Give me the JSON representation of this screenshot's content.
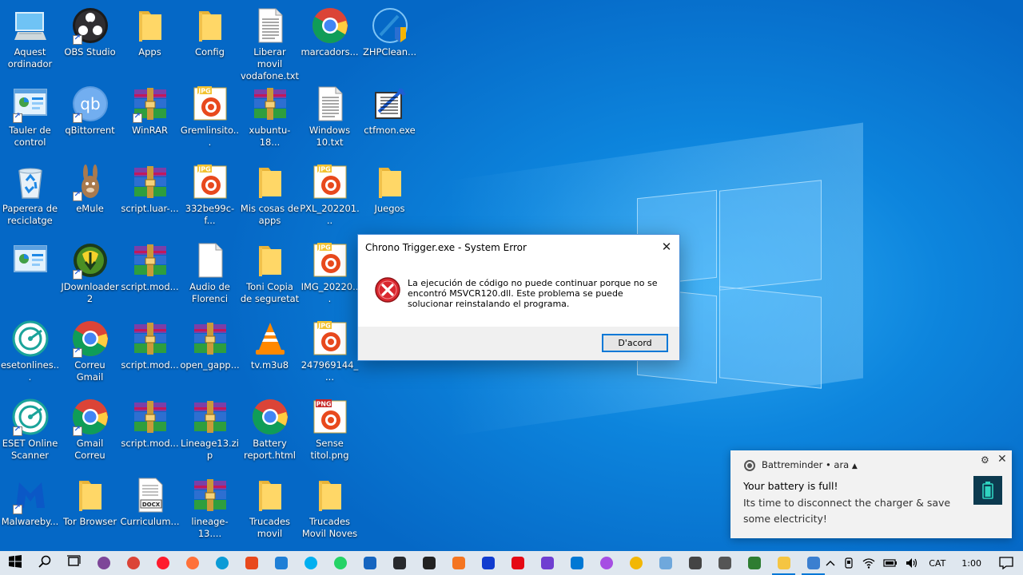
{
  "desktop": {
    "icons": [
      {
        "label": "Aquest ordinador",
        "icon": "this-pc-icon",
        "shortcut": false
      },
      {
        "label": "OBS Studio",
        "icon": "obs-icon",
        "shortcut": true
      },
      {
        "label": "Apps",
        "icon": "folder-icon",
        "shortcut": false
      },
      {
        "label": "Config",
        "icon": "folder-icon",
        "shortcut": false
      },
      {
        "label": "Liberar movil vodafone.txt",
        "icon": "text-file-icon",
        "shortcut": false
      },
      {
        "label": "marcadors...",
        "icon": "chrome-icon",
        "shortcut": false
      },
      {
        "label": "ZHPClean...",
        "icon": "zhpcleaner-icon",
        "shortcut": false
      },
      {
        "label": "Tauler de control",
        "icon": "control-panel-icon",
        "shortcut": true
      },
      {
        "label": "qBittorrent",
        "icon": "qbittorrent-icon",
        "shortcut": true
      },
      {
        "label": "WinRAR",
        "icon": "winrar-icon",
        "shortcut": true
      },
      {
        "label": "Gremlinsito...",
        "icon": "jpg-file-icon",
        "shortcut": false
      },
      {
        "label": "xubuntu-18...",
        "icon": "winrar-icon",
        "shortcut": false
      },
      {
        "label": "Windows 10.txt",
        "icon": "text-file-icon",
        "shortcut": false
      },
      {
        "label": "ctfmon.exe",
        "icon": "ctfmon-icon",
        "shortcut": false
      },
      {
        "label": "Paperera de reciclatge",
        "icon": "recycle-bin-icon",
        "shortcut": false
      },
      {
        "label": "eMule",
        "icon": "emule-icon",
        "shortcut": true
      },
      {
        "label": "script.luar-...",
        "icon": "winrar-icon",
        "shortcut": false
      },
      {
        "label": "332be99c-f...",
        "icon": "jpg-file-icon",
        "shortcut": false
      },
      {
        "label": "Mis cosas de apps",
        "icon": "folder-icon",
        "shortcut": false
      },
      {
        "label": "PXL_202201...",
        "icon": "jpg-file-icon",
        "shortcut": false
      },
      {
        "label": "Juegos",
        "icon": "folder-icon",
        "shortcut": false
      },
      {
        "label": "",
        "icon": "control-panel-icon",
        "shortcut": false
      },
      {
        "label": "JDownloader 2",
        "icon": "jdownloader-icon",
        "shortcut": true
      },
      {
        "label": "script.mod...",
        "icon": "winrar-icon",
        "shortcut": false
      },
      {
        "label": "Audio de Florenci",
        "icon": "blank-file-icon",
        "shortcut": false
      },
      {
        "label": "Toni Copia de seguretat",
        "icon": "folder-icon",
        "shortcut": false
      },
      {
        "label": "IMG_20220...",
        "icon": "jpg-file-icon",
        "shortcut": false
      },
      {
        "label": "esetonlines...",
        "icon": "eset-icon",
        "shortcut": false
      },
      {
        "label": "Correu Gmail",
        "icon": "chrome-icon",
        "shortcut": true
      },
      {
        "label": "script.mod...",
        "icon": "winrar-icon",
        "shortcut": false
      },
      {
        "label": "open_gapp...",
        "icon": "winrar-icon",
        "shortcut": false
      },
      {
        "label": "tv.m3u8",
        "icon": "vlc-icon",
        "shortcut": false
      },
      {
        "label": "247969144_...",
        "icon": "jpg-file-icon",
        "shortcut": false
      },
      {
        "label": "ESET Online Scanner",
        "icon": "eset-icon",
        "shortcut": true
      },
      {
        "label": "Gmail Correu",
        "icon": "chrome-icon",
        "shortcut": true
      },
      {
        "label": "script.mod...",
        "icon": "winrar-icon",
        "shortcut": false
      },
      {
        "label": "Lineage13.zip",
        "icon": "winrar-icon",
        "shortcut": false
      },
      {
        "label": "Battery report.html",
        "icon": "chrome-icon",
        "shortcut": false
      },
      {
        "label": "Sense titol.png",
        "icon": "png-file-icon",
        "shortcut": false
      },
      {
        "label": "Malwareby...",
        "icon": "malwarebytes-icon",
        "shortcut": true
      },
      {
        "label": "Tor Browser",
        "icon": "folder-icon",
        "shortcut": false
      },
      {
        "label": "Curriculum...",
        "icon": "docx-file-icon",
        "shortcut": false
      },
      {
        "label": "lineage-13....",
        "icon": "winrar-icon",
        "shortcut": false
      },
      {
        "label": "Trucades movil",
        "icon": "folder-icon",
        "shortcut": false
      },
      {
        "label": "Trucades Movil Noves",
        "icon": "folder-icon",
        "shortcut": false
      }
    ]
  },
  "dialog": {
    "title": "Chrono Trigger.exe - System Error",
    "message": "La ejecución de código no puede continuar porque no se encontró MSVCR120.dll. Este problema se puede solucionar reinstalando el programa.",
    "ok_label": "D'acord",
    "close_glyph": "✕"
  },
  "toast": {
    "app_name": "Battreminder",
    "time": "ara",
    "header_separator": "•",
    "title": "Your battery is full!",
    "text": "Its time to disconnect the charger & save some electricity!",
    "settings_glyph": "⚙",
    "close_glyph": "✕"
  },
  "taskbar": {
    "apps": [
      {
        "name": "start-button",
        "icon": "windows-logo-icon",
        "color": "#000000"
      },
      {
        "name": "search-button",
        "icon": "search-icon",
        "color": "#000000"
      },
      {
        "name": "task-view-button",
        "icon": "task-view-icon",
        "color": "#000000"
      },
      {
        "name": "taskbar-tor",
        "icon": "tor-icon",
        "color": "#7d4698"
      },
      {
        "name": "taskbar-chrome",
        "icon": "chrome-icon",
        "color": "#db4437"
      },
      {
        "name": "taskbar-opera",
        "icon": "opera-icon",
        "color": "#ff1b2d"
      },
      {
        "name": "taskbar-firefox",
        "icon": "firefox-icon",
        "color": "#ff7139"
      },
      {
        "name": "taskbar-edge",
        "icon": "edge-icon",
        "color": "#0c9bd6"
      },
      {
        "name": "taskbar-ccleaner",
        "icon": "ccleaner-icon",
        "color": "#e8491d"
      },
      {
        "name": "taskbar-jdownloader",
        "icon": "jdownloader-icon",
        "color": "#1f7fd6"
      },
      {
        "name": "taskbar-skype",
        "icon": "skype-icon",
        "color": "#00aff0"
      },
      {
        "name": "taskbar-whatsapp",
        "icon": "whatsapp-icon",
        "color": "#25d366"
      },
      {
        "name": "taskbar-display",
        "icon": "monitor-icon",
        "color": "#1565c0"
      },
      {
        "name": "taskbar-plex",
        "icon": "plex-icon",
        "color": "#282a2d"
      },
      {
        "name": "taskbar-media",
        "icon": "media-icon",
        "color": "#222222"
      },
      {
        "name": "taskbar-crunchyroll",
        "icon": "crunchyroll-icon",
        "color": "#f47521"
      },
      {
        "name": "taskbar-disney",
        "icon": "disney-plus-icon",
        "color": "#113ccf"
      },
      {
        "name": "taskbar-netflix",
        "icon": "netflix-icon",
        "color": "#e50914"
      },
      {
        "name": "taskbar-zt",
        "icon": "zt-icon",
        "color": "#6f3fd1"
      },
      {
        "name": "taskbar-mail",
        "icon": "mail-icon",
        "color": "#0078d4"
      },
      {
        "name": "taskbar-paint",
        "icon": "paint-drop-icon",
        "color": "#a64ee3"
      },
      {
        "name": "taskbar-sticky",
        "icon": "sticky-icon",
        "color": "#f2b705"
      },
      {
        "name": "taskbar-notepad",
        "icon": "notepad-icon",
        "color": "#6fa8dc"
      },
      {
        "name": "taskbar-camera",
        "icon": "camera-icon",
        "color": "#444444"
      },
      {
        "name": "taskbar-calculator",
        "icon": "calculator-icon",
        "color": "#555555"
      },
      {
        "name": "taskbar-photos",
        "icon": "photos-icon",
        "color": "#2e7d32"
      },
      {
        "name": "taskbar-explorer",
        "icon": "file-explorer-icon",
        "color": "#f5c542",
        "active": true
      },
      {
        "name": "taskbar-control-panel",
        "icon": "control-panel-icon",
        "color": "#3b7fd0",
        "active": true
      }
    ],
    "tray": {
      "chevron": "^",
      "language": "CAT",
      "time": "1:00"
    }
  },
  "colors": {
    "accent": "#0078d7",
    "desktop_blue": "#0a78d7",
    "error_red": "#d9272e"
  }
}
